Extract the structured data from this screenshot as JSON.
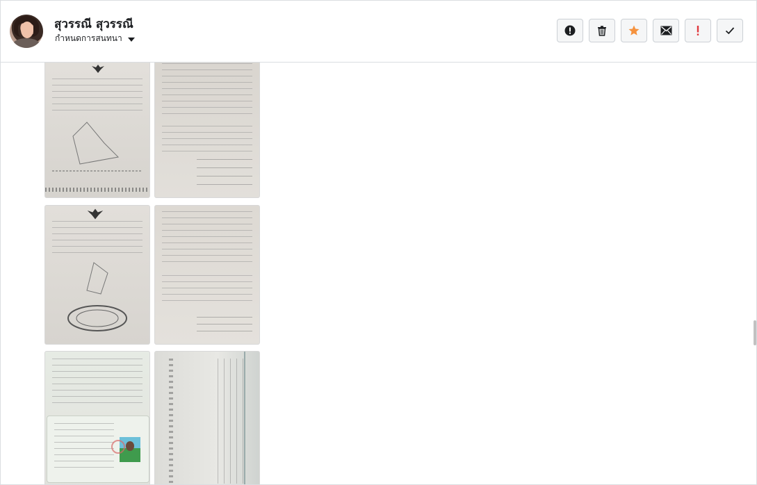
{
  "header": {
    "contact_name": "สุวรรณี สุวรรณี",
    "subtitle": "กำหนดการสนทนา",
    "actions": [
      {
        "name": "report-icon"
      },
      {
        "name": "trash-icon"
      },
      {
        "name": "star-icon",
        "color": "#f5923e"
      },
      {
        "name": "mail-icon"
      },
      {
        "name": "important-icon",
        "color": "#e0393e"
      },
      {
        "name": "checkmark-icon"
      }
    ]
  },
  "attachments": [
    {
      "name": "land-deed-front-1"
    },
    {
      "name": "document-page-1"
    },
    {
      "name": "land-deed-front-2"
    },
    {
      "name": "document-page-2"
    },
    {
      "name": "id-card-photo"
    },
    {
      "name": "house-registration-photo"
    }
  ]
}
